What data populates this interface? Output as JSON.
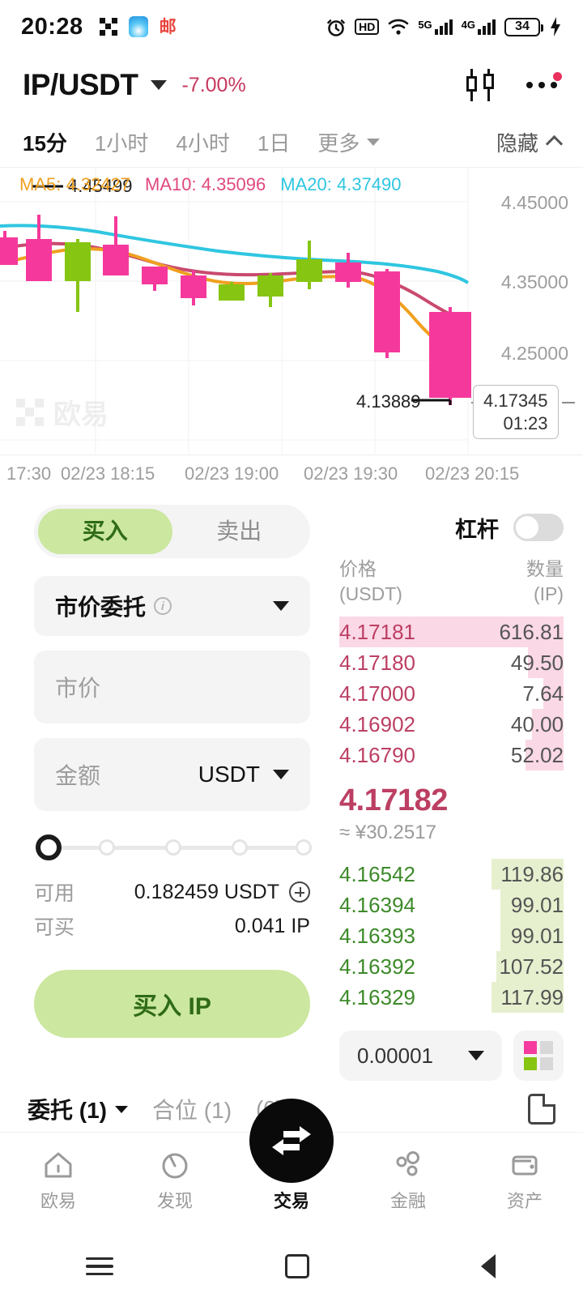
{
  "status_bar": {
    "time": "20:28",
    "battery_percent": "34",
    "icons": [
      "mosaic-icon",
      "assistant-icon",
      "red-char-icon",
      "alarm-icon",
      "hd-voice-icon",
      "wifi-icon",
      "signal-5g-icon",
      "signal-4g-icon",
      "battery-icon",
      "charging-icon"
    ],
    "hd_label": "HD",
    "net_5g": "5G",
    "net_4g": "4G"
  },
  "header": {
    "pair": "IP/USDT",
    "change": "-7.00%",
    "change_color": "#c7395f"
  },
  "timeframes": {
    "items": [
      {
        "label": "15分",
        "active": true
      },
      {
        "label": "1小时",
        "active": false
      },
      {
        "label": "4小时",
        "active": false
      },
      {
        "label": "1日",
        "active": false
      }
    ],
    "more_label": "更多",
    "hide_label": "隐藏"
  },
  "chart_data": {
    "type": "line",
    "title": "",
    "xlabel": "",
    "ylabel": "",
    "ma_legend": [
      {
        "name": "MA5",
        "value": "4.32427",
        "color": "#f0a020"
      },
      {
        "name": "MA10",
        "value": "4.35096",
        "color": "#e0487f"
      },
      {
        "name": "MA20",
        "value": "4.37490",
        "color": "#2fc6e0"
      }
    ],
    "y_ticks": [
      "4.45000",
      "4.35000",
      "4.25000"
    ],
    "x_ticks": [
      "17:30",
      "02/23 18:15",
      "02/23 19:00",
      "02/23 19:30",
      "02/23 20:15"
    ],
    "high_label": "4.45499",
    "low_label": "4.13889",
    "last_price": "4.17345",
    "countdown": "01:23",
    "watermark": "欧易",
    "ylim": [
      4.1,
      4.47
    ],
    "candles": [
      {
        "o": 4.404,
        "h": 4.412,
        "l": 4.395,
        "c": 4.392,
        "dir": "down"
      },
      {
        "o": 4.43,
        "h": 4.455,
        "l": 4.4,
        "c": 4.385,
        "dir": "down"
      },
      {
        "o": 4.385,
        "h": 4.42,
        "l": 4.33,
        "c": 4.408,
        "dir": "up"
      },
      {
        "o": 4.418,
        "h": 4.455,
        "l": 4.382,
        "c": 4.392,
        "dir": "down"
      },
      {
        "o": 4.381,
        "h": 4.383,
        "l": 4.362,
        "c": 4.372,
        "dir": "down"
      },
      {
        "o": 4.375,
        "h": 4.378,
        "l": 4.348,
        "c": 4.36,
        "dir": "down"
      },
      {
        "o": 4.36,
        "h": 4.368,
        "l": 4.332,
        "c": 4.358,
        "dir": "up"
      },
      {
        "o": 4.352,
        "h": 4.366,
        "l": 4.328,
        "c": 4.366,
        "dir": "up"
      },
      {
        "o": 4.366,
        "h": 4.4,
        "l": 4.355,
        "c": 4.378,
        "dir": "up"
      },
      {
        "o": 4.378,
        "h": 4.385,
        "l": 4.358,
        "c": 4.372,
        "dir": "down"
      },
      {
        "o": 4.372,
        "h": 4.378,
        "l": 4.23,
        "c": 4.232,
        "dir": "down"
      },
      {
        "o": 4.258,
        "h": 4.262,
        "l": 4.139,
        "c": 4.173,
        "dir": "down"
      }
    ]
  },
  "trade_form": {
    "side_tabs": [
      {
        "label": "买入",
        "active": true
      },
      {
        "label": "卖出",
        "active": false
      }
    ],
    "order_type": "市价委托",
    "price_placeholder": "市价",
    "amount_placeholder": "金额",
    "amount_unit": "USDT",
    "slider_percent": 0,
    "available_label": "可用",
    "available_value": "0.182459 USDT",
    "buyable_label": "可买",
    "buyable_value": "0.041 IP",
    "submit_label": "买入 IP"
  },
  "order_book": {
    "leverage_label": "杠杆",
    "leverage_on": false,
    "col_price": "价格",
    "col_price_unit": "(USDT)",
    "col_qty": "数量",
    "col_qty_unit": "(IP)",
    "asks": [
      {
        "price": "4.17181",
        "qty": "616.81",
        "depth": 100,
        "highlight": true
      },
      {
        "price": "4.17180",
        "qty": "49.50",
        "depth": 16
      },
      {
        "price": "4.17000",
        "qty": "7.64",
        "depth": 9
      },
      {
        "price": "4.16902",
        "qty": "40.00",
        "depth": 14
      },
      {
        "price": "4.16790",
        "qty": "52.02",
        "depth": 17
      }
    ],
    "mid_price": "4.17182",
    "fiat_price": "≈ ¥30.2517",
    "bids": [
      {
        "price": "4.16542",
        "qty": "119.86",
        "depth": 32
      },
      {
        "price": "4.16394",
        "qty": "99.01",
        "depth": 28
      },
      {
        "price": "4.16393",
        "qty": "99.01",
        "depth": 28
      },
      {
        "price": "4.16392",
        "qty": "107.52",
        "depth": 30
      },
      {
        "price": "4.16329",
        "qty": "117.99",
        "depth": 32
      }
    ],
    "tick_size": "0.00001",
    "depth_view_icon": "depth-layout-icon"
  },
  "orders_tabs": [
    {
      "label": "委托 (1)",
      "active": true,
      "caret": true
    },
    {
      "label": "合位 (1)",
      "active": false
    },
    {
      "label": "(0)",
      "active": false
    }
  ],
  "bottom_nav": [
    {
      "label": "欧易",
      "icon": "home-icon",
      "active": false
    },
    {
      "label": "发现",
      "icon": "compass-icon",
      "active": false
    },
    {
      "label": "交易",
      "icon": "swap-icon",
      "active": true
    },
    {
      "label": "金融",
      "icon": "finance-icon",
      "active": false
    },
    {
      "label": "资产",
      "icon": "wallet-icon",
      "active": false
    }
  ],
  "android_nav": [
    "menu-icon",
    "home-square-icon",
    "back-icon"
  ]
}
